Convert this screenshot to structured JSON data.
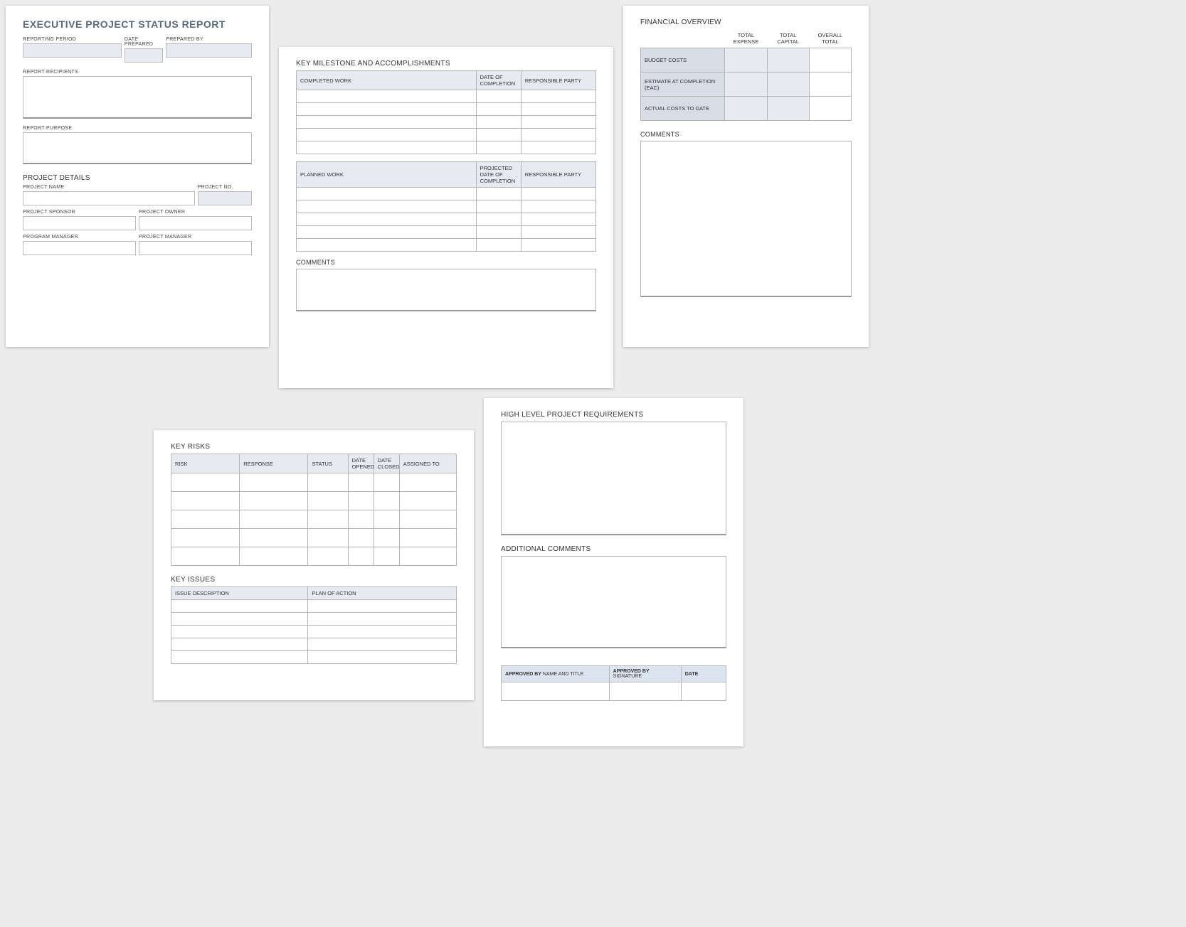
{
  "card1": {
    "title": "EXECUTIVE PROJECT STATUS REPORT",
    "labels": {
      "reporting_period": "REPORTING PERIOD",
      "date_prepared": "DATE PREPARED",
      "prepared_by": "PREPARED BY",
      "report_recipients": "REPORT RECIPIENTS",
      "report_purpose": "REPORT PURPOSE",
      "project_details": "PROJECT DETAILS",
      "project_name": "PROJECT NAME",
      "project_no": "PROJECT NO.",
      "project_sponsor": "PROJECT SPONSOR",
      "project_owner": "PROJECT OWNER",
      "program_manager": "PROGRAM MANAGER",
      "project_manager": "PROJECT MANAGER"
    }
  },
  "card2": {
    "title": "KEY MILESTONE AND ACCOMPLISHMENTS",
    "completed": {
      "h1": "COMPLETED WORK",
      "h2": "DATE OF COMPLETION",
      "h3": "RESPONSIBLE PARTY"
    },
    "planned": {
      "h1": "PLANNED WORK",
      "h2": "PROJECTED DATE OF COMPLETION",
      "h3": "RESPONSIBLE PARTY"
    },
    "comments": "COMMENTS"
  },
  "card3": {
    "title": "FINANCIAL OVERVIEW",
    "cols": {
      "c1": "TOTAL EXPENSE",
      "c2": "TOTAL CAPITAL",
      "c3": "OVERALL TOTAL"
    },
    "rows": {
      "r1": "BUDGET COSTS",
      "r2": "ESTIMATE AT COMPLETION (EAC)",
      "r3": "ACTUAL COSTS TO DATE"
    },
    "comments": "COMMENTS"
  },
  "card4": {
    "risks_title": "KEY RISKS",
    "risks_headers": {
      "h1": "RISK",
      "h2": "RESPONSE",
      "h3": "STATUS",
      "h4": "DATE OPENED",
      "h5": "DATE CLOSED",
      "h6": "ASSIGNED TO"
    },
    "issues_title": "KEY ISSUES",
    "issues_headers": {
      "h1": "ISSUE DESCRIPTION",
      "h2": "PLAN OF ACTION"
    }
  },
  "card5": {
    "req_title": "HIGH LEVEL PROJECT REQUIREMENTS",
    "addl_title": "ADDITIONAL COMMENTS",
    "approve": {
      "h1a": "APPROVED BY",
      "h1b": " NAME AND TITLE",
      "h2a": "APPROVED BY",
      "h2b": " SIGNATURE",
      "h3": "DATE"
    }
  }
}
